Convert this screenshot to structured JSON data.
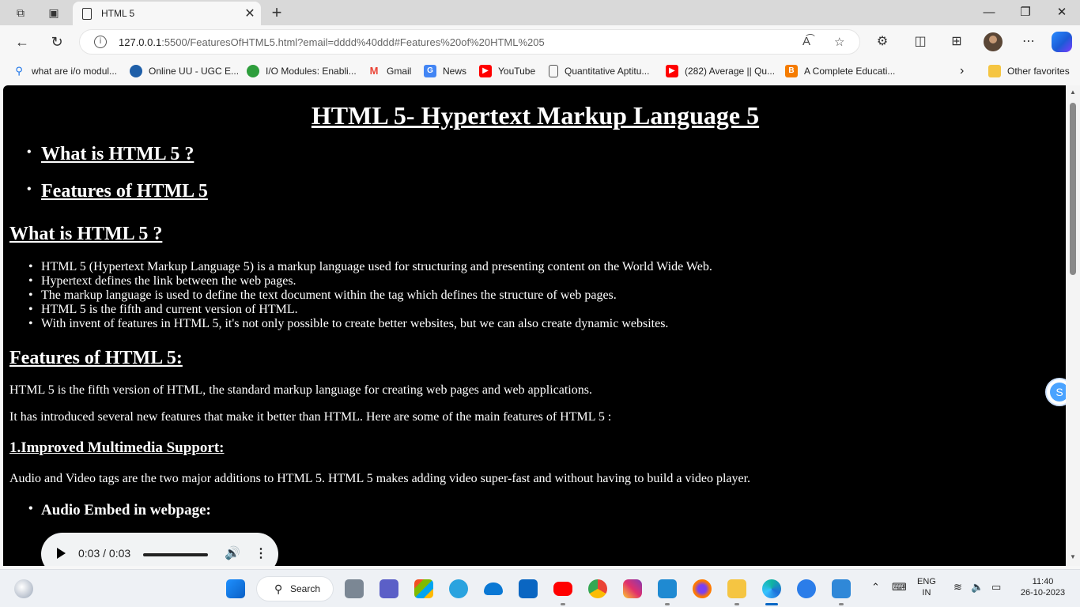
{
  "browser": {
    "tab_title": "HTML 5",
    "url_host": "127.0.0.1",
    "url_rest": ":5500/FeaturesOfHTML5.html?email=dddd%40ddd#Features%20of%20HTML%205",
    "favorites": [
      {
        "label": "what are i/o modul...",
        "icon": "search-icon",
        "color": "#1a73e8"
      },
      {
        "label": "Online UU - UGC E...",
        "icon": "uu-icon",
        "color": "#1f5fa8"
      },
      {
        "label": "I/O Modules: Enabli...",
        "icon": "leaf-icon",
        "color": "#2e9e3c"
      },
      {
        "label": "Gmail",
        "icon": "gmail-icon",
        "color": "#ea4335"
      },
      {
        "label": "News",
        "icon": "news-icon",
        "color": "#4285f4"
      },
      {
        "label": "YouTube",
        "icon": "youtube-icon",
        "color": "#ff0000"
      },
      {
        "label": "Quantitative Aptitu...",
        "icon": "doc-icon",
        "color": "#555555"
      },
      {
        "label": "(282) Average || Qu...",
        "icon": "youtube-icon",
        "color": "#ff0000"
      },
      {
        "label": "A Complete Educati...",
        "icon": "blogger-icon",
        "color": "#f57c00"
      }
    ],
    "other_favorites": "Other favorites"
  },
  "page": {
    "title": "HTML 5- Hypertext Markup Language 5",
    "toc": [
      "What is HTML 5 ?",
      "Features of HTML 5"
    ],
    "what_heading": "What is HTML 5 ?",
    "what_points": [
      "HTML 5 (Hypertext Markup Language 5) is a markup language used for structuring and presenting content on the World Wide Web.",
      "Hypertext defines the link between the web pages.",
      "The markup language is used to define the text document within the tag which defines the structure of web pages.",
      "HTML 5 is the fifth and current version of HTML.",
      "With invent of features in HTML 5, it's not only possible to create better websites, but we can also create dynamic websites."
    ],
    "features_heading": "Features of HTML 5:",
    "features_p1": "HTML 5 is the fifth version of HTML, the standard markup language for creating web pages and web applications.",
    "features_p2": "It has introduced several new features that make it better than HTML. Here are some of the main features of HTML 5 :",
    "multimedia_heading": "1.Improved Multimedia Support:",
    "multimedia_p": "Audio and Video tags are the two major additions to HTML 5. HTML 5 makes adding video super-fast and without having to build a video player.",
    "audio_heading": "Audio Embed in webpage:",
    "audio_time": "0:03 / 0:03",
    "side_badge": "S"
  },
  "taskbar": {
    "search_label": "Search",
    "lang_line1": "ENG",
    "lang_line2": "IN",
    "time": "11:40",
    "date": "26-10-2023"
  }
}
